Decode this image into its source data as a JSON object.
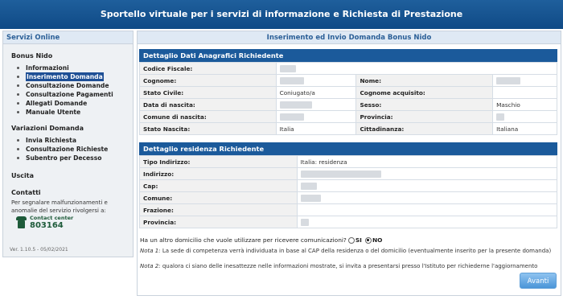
{
  "header": {
    "title": "Sportello virtuale per i servizi di informazione e Richiesta di Prestazione"
  },
  "sidebar": {
    "title": "Servizi Online",
    "sections": [
      {
        "title": "Bonus Nido",
        "items": [
          {
            "label": "Informazioni",
            "active": false
          },
          {
            "label": "Inserimento Domanda",
            "active": true
          },
          {
            "label": "Consultazione Domande",
            "active": false
          },
          {
            "label": "Consultazione Pagamenti",
            "active": false
          },
          {
            "label": "Allegati Domande",
            "active": false
          },
          {
            "label": "Manuale Utente",
            "active": false
          }
        ]
      },
      {
        "title": "Variazioni Domanda",
        "items": [
          {
            "label": "Invia Richiesta"
          },
          {
            "label": "Consultazione Richieste"
          },
          {
            "label": "Subentro per Decesso"
          }
        ]
      }
    ],
    "uscita": "Uscita",
    "contatti": {
      "title": "Contatti",
      "text": "Per segnalare malfunzionamenti e anomalie del servizio rivolgersi a:",
      "center_label": "Contact center",
      "center_number": "803164"
    },
    "version": "Ver. 1.10.5 - 05/02/2021"
  },
  "main": {
    "title": "Inserimento ed Invio Domanda Bonus Nido",
    "anagrafici": {
      "title": "Dettaglio Dati Anagrafici Richiedente",
      "rows": [
        {
          "l1": "Codice Fiscale:",
          "v1": "",
          "l2": "",
          "v2": ""
        },
        {
          "l1": "Cognome:",
          "v1": "",
          "l2": "Nome:",
          "v2": ""
        },
        {
          "l1": "Stato Civile:",
          "v1": "Coniugato/a",
          "l2": "Cognome acquisito:",
          "v2": ""
        },
        {
          "l1": "Data di nascita:",
          "v1": "",
          "l2": "Sesso:",
          "v2": "Maschio"
        },
        {
          "l1": "Comune di nascita:",
          "v1": "",
          "l2": "Provincia:",
          "v2": ""
        },
        {
          "l1": "Stato Nascita:",
          "v1": "Italia",
          "l2": "Cittadinanza:",
          "v2": "Italiana"
        }
      ]
    },
    "residenza": {
      "title": "Dettaglio residenza Richiedente",
      "rows": [
        {
          "label": "Tipo Indirizzo:",
          "value": "Italia: residenza"
        },
        {
          "label": "Indirizzo:",
          "value": ""
        },
        {
          "label": "Cap:",
          "value": ""
        },
        {
          "label": "Comune:",
          "value": ""
        },
        {
          "label": "Frazione:",
          "value": ""
        },
        {
          "label": "Provincia:",
          "value": ""
        }
      ]
    },
    "question": "Ha un altro domicilio che vuole utilizzare per ricevere comunicazioni?",
    "opt_si": "SI",
    "opt_no": "NO",
    "note1_label": "Nota 1:",
    "note1": "La sede di competenza verrà individuata in base al CAP della residenza o del domicilio (eventualmente inserito per la presente domanda)",
    "note2_label": "Nota 2:",
    "note2": "qualora ci siano delle inesattezze nelle informazioni mostrate, si invita a presentarsi presso l'Istituto per richiederne l'aggiornamento",
    "button": "Avanti"
  }
}
